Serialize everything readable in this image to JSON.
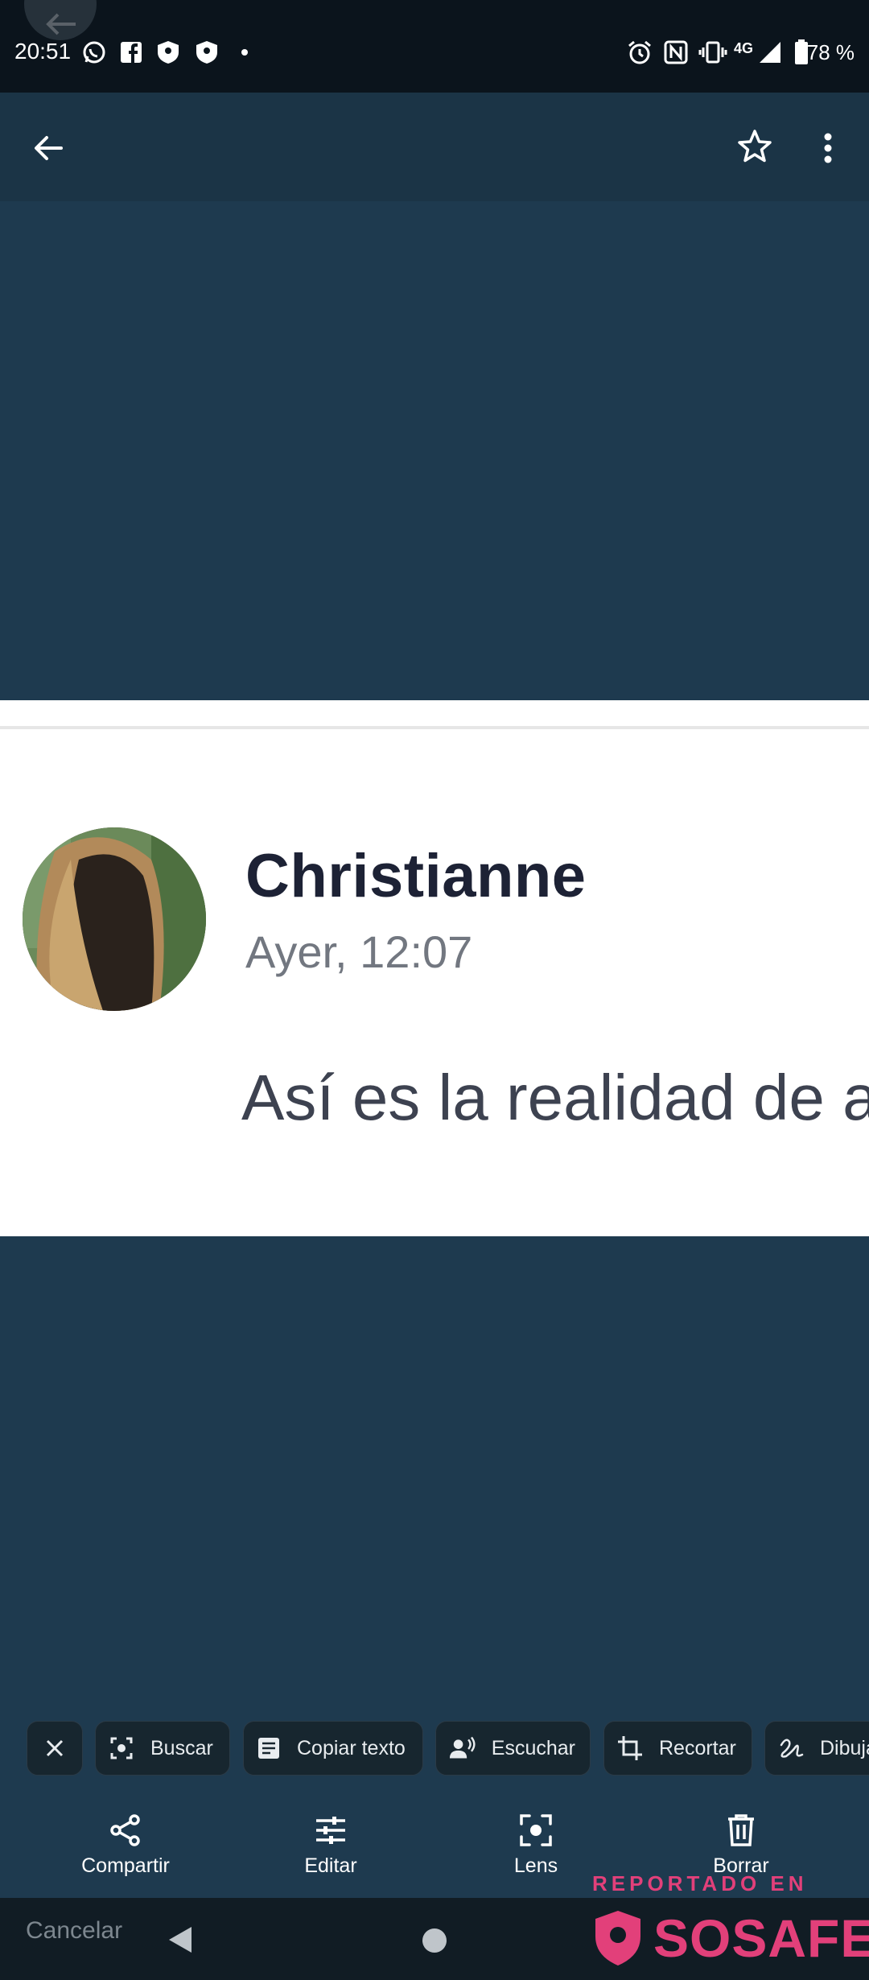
{
  "status_bar": {
    "time": "20:51",
    "network": "4G",
    "battery": "78 %",
    "left_icons": [
      "whatsapp-icon",
      "facebook-icon",
      "shield-icon",
      "shield-icon",
      "dot-icon"
    ],
    "right_icons": [
      "alarm-icon",
      "nfc-icon",
      "vibrate-icon",
      "signal-icon",
      "battery-icon"
    ]
  },
  "header": {
    "back_icon": "arrow-left-icon",
    "favorite_icon": "star-outline-icon",
    "more_icon": "more-vert-icon"
  },
  "photo": {
    "name": "Christianne",
    "timestamp": "Ayer, 12:07",
    "message": "Así es la realidad de a"
  },
  "chips": [
    {
      "label": "",
      "icon": "close-icon"
    },
    {
      "label": "Buscar",
      "icon": "lens-search-icon"
    },
    {
      "label": "Copiar texto",
      "icon": "text-doc-icon"
    },
    {
      "label": "Escuchar",
      "icon": "voice-icon"
    },
    {
      "label": "Recortar",
      "icon": "crop-icon"
    },
    {
      "label": "Dibuja",
      "icon": "draw-icon"
    }
  ],
  "actions": [
    {
      "label": "Compartir",
      "icon": "share-icon"
    },
    {
      "label": "Editar",
      "icon": "tune-icon"
    },
    {
      "label": "Lens",
      "icon": "lens-icon"
    },
    {
      "label": "Borrar",
      "icon": "trash-icon"
    }
  ],
  "nav": {
    "cancel": "Cancelar"
  },
  "watermark": {
    "line1": "REPORTADO EN",
    "line2": "SOSAFE"
  },
  "colors": {
    "background": "#1e3a4f",
    "watermark": "#e2407a"
  }
}
